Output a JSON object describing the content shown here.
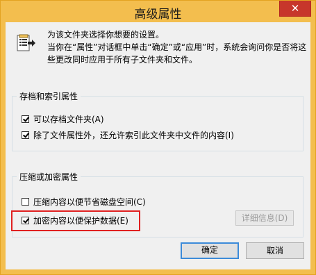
{
  "window": {
    "title": "高级属性",
    "close_glyph": "✕"
  },
  "intro": {
    "icon": "folder-properties-icon",
    "line1": "为该文件夹选择你想要的设置。",
    "line2": "当你在“属性”对话框中单击“确定”或“应用”时，系统会询问你是否将这",
    "line3": "些更改同时应用于所有子文件夹和文件。"
  },
  "archive_group": {
    "title": "存档和索引属性",
    "options": [
      {
        "label": "可以存档文件夹(A)",
        "checked": true
      },
      {
        "label": "除了文件属性外，还允许索引此文件夹中文件的内容(I)",
        "checked": true
      }
    ]
  },
  "compress_group": {
    "title": "压缩或加密属性",
    "options": [
      {
        "label": "压缩内容以便节省磁盘空间(C)",
        "checked": false
      },
      {
        "label": "加密内容以便保护数据(E)",
        "checked": true
      }
    ],
    "details_label": "详细信息(D)"
  },
  "buttons": {
    "ok": "确定",
    "cancel": "取消"
  },
  "colors": {
    "titlebar": "#f3be4e",
    "close": "#c7362b",
    "highlight": "#e02020",
    "default_button_border": "#3c8bd9"
  }
}
